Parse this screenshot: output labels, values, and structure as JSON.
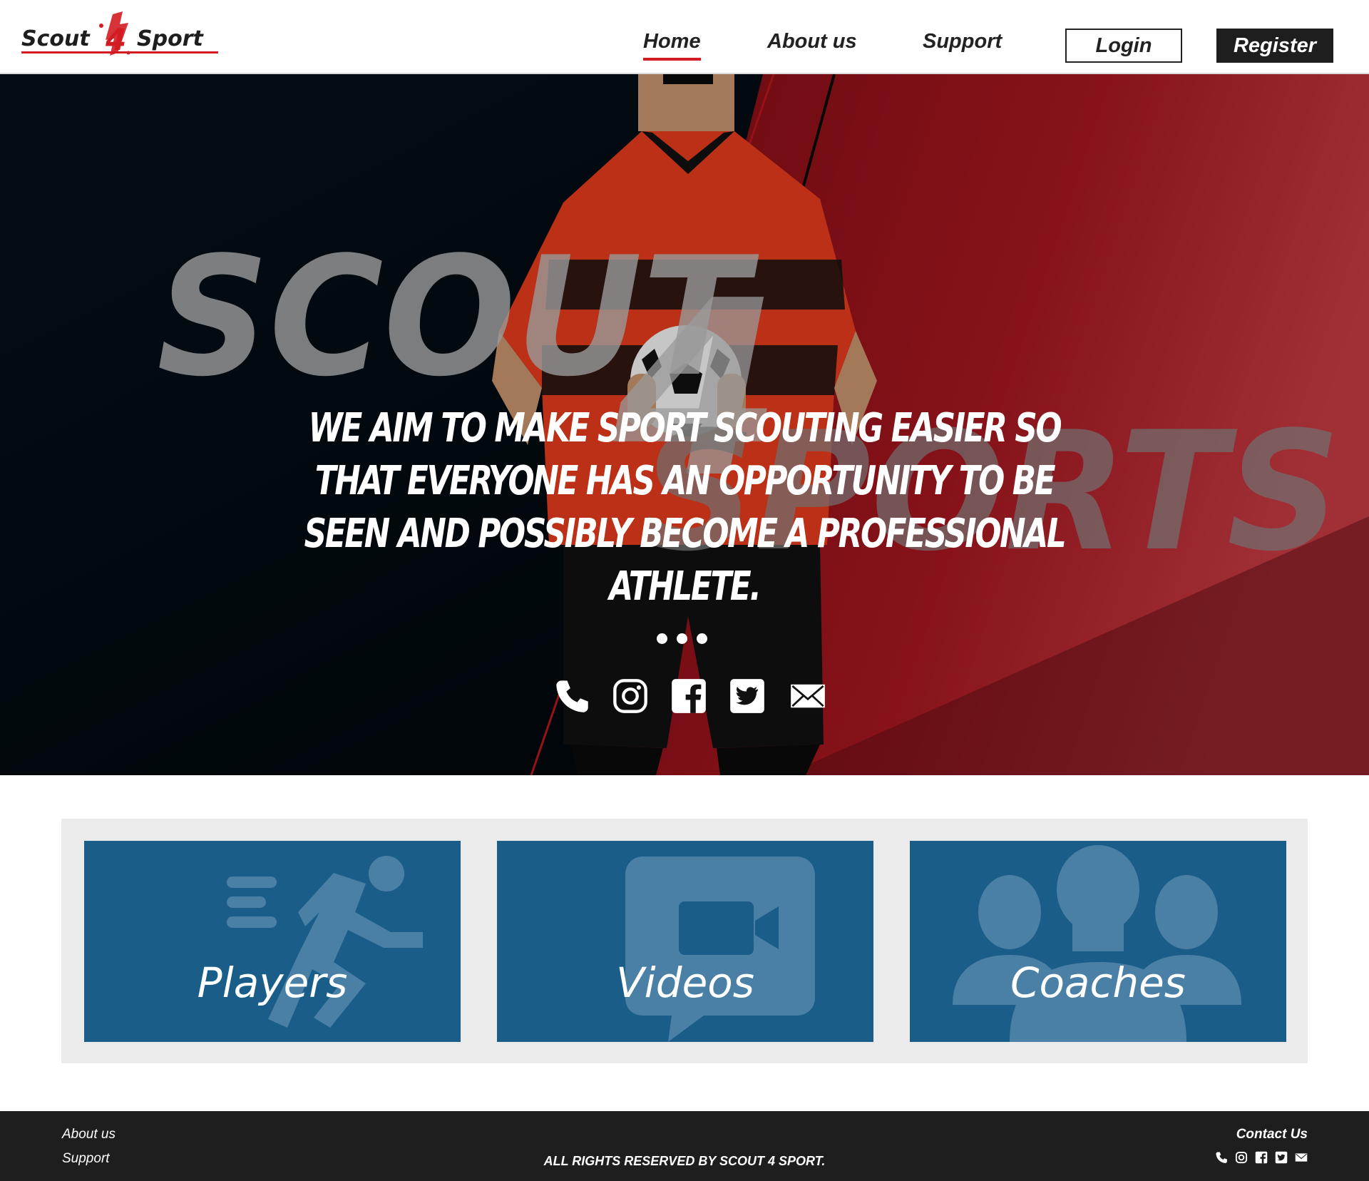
{
  "header": {
    "logo_text_left": "Scout",
    "logo_number": "4",
    "logo_text_right": "Sport",
    "nav": {
      "home": "Home",
      "about": "About us",
      "support": "Support"
    },
    "login_label": "Login",
    "register_label": "Register"
  },
  "hero": {
    "bg_word_1": "SCOUT",
    "bg_word_2": "4",
    "bg_word_3": "SPORTS",
    "tagline": "We aim to make sport scouting easier so that everyone has an opportunity to be seen and possibly become a professional athlete.",
    "carousel_dots": 3,
    "social_icons": [
      "phone-icon",
      "instagram-icon",
      "facebook-icon",
      "twitter-icon",
      "mail-icon"
    ]
  },
  "cards": {
    "players": "Players",
    "videos": "Videos",
    "coaches": "Coaches"
  },
  "footer": {
    "about": "About us",
    "support": "Support",
    "copyright": "ALL RIGHTS RESERVED BY SCOUT 4 SPORT.",
    "contact_title": "Contact Us",
    "social_icons": [
      "phone-icon",
      "instagram-icon",
      "facebook-icon",
      "twitter-icon",
      "mail-icon"
    ]
  },
  "colors": {
    "brand_red": "#d21c22",
    "card_blue": "#1a5d89",
    "dark": "#1e1e1e"
  }
}
